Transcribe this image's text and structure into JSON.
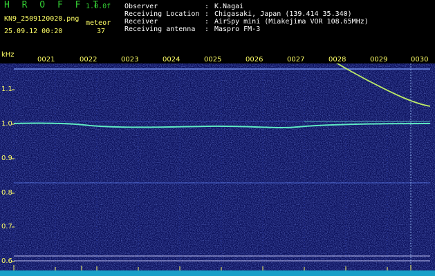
{
  "header": {
    "brand": "H R O F F T",
    "version": "1.0.0f",
    "filename": "KN9_2509120020.png",
    "datetime": "25.09.12 00:20",
    "meteor_label": "meteor",
    "meteor_count": "37",
    "info": [
      {
        "label": "Observer",
        "value": "K.Nagai"
      },
      {
        "label": "Receiving Location",
        "value": "Chigasaki, Japan (139.414 35.340)"
      },
      {
        "label": "Receiver",
        "value": "AirSpy mini (Miakejima VOR 108.65MHz)"
      },
      {
        "label": "Receiving antenna",
        "value": "Maspro FM-3"
      }
    ]
  },
  "axis": {
    "y_unit": "kHz",
    "x_ticks": [
      "0021",
      "0022",
      "0023",
      "0024",
      "0025",
      "0026",
      "0027",
      "0028",
      "0029",
      "0030"
    ],
    "y_ticks": [
      "1.1",
      "1.0",
      "0.9",
      "0.8",
      "0.7",
      "0.6"
    ]
  },
  "colors": {
    "background": "#0a0f5a",
    "label": "#ffff66",
    "trace": "#66ffcc"
  }
}
